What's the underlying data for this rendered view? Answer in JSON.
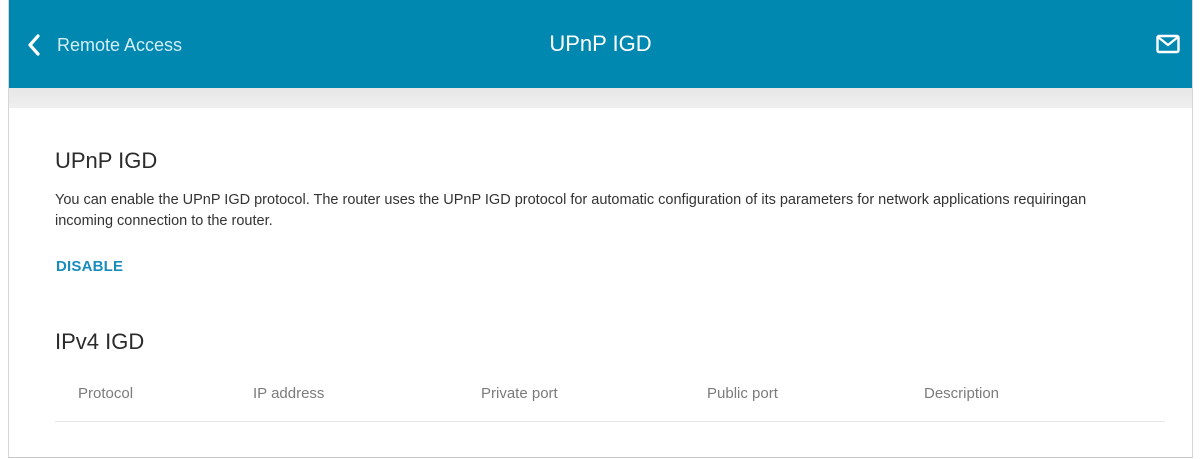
{
  "header": {
    "back_label": "Remote Access",
    "title": "UPnP IGD",
    "back_icon": "chevron-left-icon",
    "mail_icon": "envelope-icon",
    "color": "#0088b1"
  },
  "upnp": {
    "title": "UPnP IGD",
    "description": "You can enable the UPnP IGD protocol. The router uses the UPnP IGD protocol for automatic configuration of its parameters for network applications requiringan incoming connection to the router.",
    "action_label": "DISABLE"
  },
  "ipv4": {
    "title": "IPv4 IGD",
    "columns": [
      "Protocol",
      "IP address",
      "Private port",
      "Public port",
      "Description"
    ]
  }
}
